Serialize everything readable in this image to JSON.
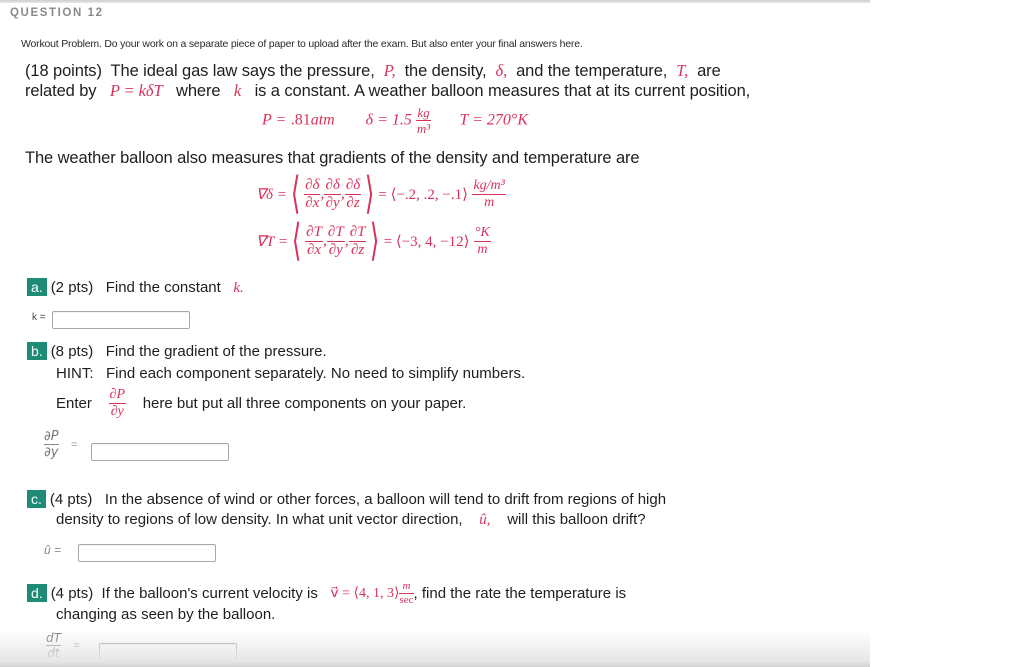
{
  "question": {
    "title": "QUESTION 12",
    "instructions": "Workout Problem. Do your work on a separate piece of paper to upload after the exam. But also enter your final answers here."
  },
  "intro": {
    "points": "(18 points)",
    "line1_a": "The ideal gas law says the pressure,",
    "sym_P": "P,",
    "line1_b": "the density,",
    "sym_delta": "δ,",
    "line1_c": "and the temperature,",
    "sym_T": "T,",
    "line1_d": "are",
    "line2_a": "related by",
    "law": "P = kδT",
    "line2_b": "where",
    "sym_k": "k",
    "line2_c": "is a constant. A weather balloon measures that at its current position,"
  },
  "measurements": {
    "P_label": "P =",
    "P_value": ".81",
    "P_unit": "atm",
    "delta_label": "δ = 1.5",
    "delta_unit_num": "kg",
    "delta_unit_den": "m³",
    "T_label": "T = 270°K"
  },
  "gradients": {
    "intro": "The weather balloon also measures that gradients of the density and temperature are",
    "density": {
      "lhs": "∇δ =",
      "partials": [
        {
          "num": "∂δ",
          "den": "∂x"
        },
        {
          "num": "∂δ",
          "den": "∂y"
        },
        {
          "num": "∂δ",
          "den": "∂z"
        }
      ],
      "value": "= ⟨−.2, .2, −.1⟩",
      "unit_num": "kg/m³",
      "unit_den": "m"
    },
    "temperature": {
      "lhs": "∇T =",
      "partials": [
        {
          "num": "∂T",
          "den": "∂x"
        },
        {
          "num": "∂T",
          "den": "∂y"
        },
        {
          "num": "∂T",
          "den": "∂z"
        }
      ],
      "value": "= ⟨−3, 4, −12⟩",
      "unit_num": "°K",
      "unit_den": "m"
    }
  },
  "parts": {
    "a": {
      "badge": "a.",
      "points": "(2 pts)",
      "text": "Find the constant",
      "sym": "k.",
      "answer_label": "k =",
      "answer_value": ""
    },
    "b": {
      "badge": "b.",
      "points": "(8 pts)",
      "text": "Find the gradient of the pressure.",
      "hint_label": "HINT:",
      "hint_text": "Find each component separately. No need to simplify numbers.",
      "enter_label": "Enter",
      "frac_num": "∂P",
      "frac_den": "∂y",
      "enter_tail": "here but put all three components on your paper.",
      "answer_num": "∂P",
      "answer_den": "∂y",
      "answer_eq": "=",
      "answer_value": ""
    },
    "c": {
      "badge": "c.",
      "points": "(4 pts)",
      "text1": "In the absence of wind or other forces, a balloon will tend to drift from regions of high",
      "text2_a": "density to regions of low density. In what unit vector direction,",
      "sym": "û,",
      "text2_b": "will this balloon drift?",
      "answer_label": "û =",
      "answer_value": ""
    },
    "d": {
      "badge": "d.",
      "points": "(4 pts)",
      "text1_a": "If the balloon's current velocity is",
      "velocity": "v⃗ = ⟨4, 1, 3⟩",
      "velocity_unit_num": "m",
      "velocity_unit_den": "sec",
      "text1_b": ", find the rate the temperature is",
      "text2": "changing as seen by the balloon.",
      "answer_num": "dT",
      "answer_den": "dt",
      "answer_eq": "=",
      "answer_value": ""
    }
  },
  "colors": {
    "badge": "#1e8b76",
    "math": "#d6335a",
    "title": "#8a8a8a"
  }
}
